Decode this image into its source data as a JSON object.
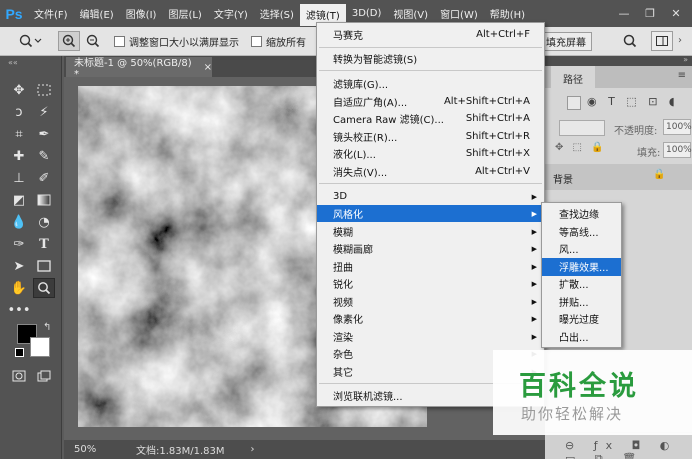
{
  "app": {
    "logo": "Ps",
    "accent": "#1c6fd1"
  },
  "menubar": {
    "items": [
      "文件(F)",
      "编辑(E)",
      "图像(I)",
      "图层(L)",
      "文字(Y)",
      "选择(S)",
      "滤镜(T)",
      "3D(D)",
      "视图(V)",
      "窗口(W)",
      "帮助(H)"
    ],
    "active": "滤镜(T)",
    "controls": [
      "—",
      "❐",
      "✕"
    ]
  },
  "options_bar": {
    "checkbox_resize": "调整窗口大小以满屏显示",
    "checkbox_zoom_all": "缩放所有",
    "fill_screen": "填充屏幕"
  },
  "document": {
    "tab_title": "未标题-1 @ 50%(RGB/8) *",
    "tab_close": "×",
    "zoom": "50%",
    "doc_info": "文档:1.83M/1.83M",
    "status_arrow": "›"
  },
  "filter_menu": {
    "items": [
      {
        "label": "马赛克",
        "shortcut": "Alt+Ctrl+F"
      },
      {
        "label": "转换为智能滤镜(S)",
        "shortcut": ""
      },
      {
        "label": "滤镜库(G)...",
        "shortcut": ""
      },
      {
        "label": "自适应广角(A)...",
        "shortcut": "Alt+Shift+Ctrl+A"
      },
      {
        "label": "Camera Raw 滤镜(C)...",
        "shortcut": "Shift+Ctrl+A"
      },
      {
        "label": "镜头校正(R)...",
        "shortcut": "Shift+Ctrl+R"
      },
      {
        "label": "液化(L)...",
        "shortcut": "Shift+Ctrl+X"
      },
      {
        "label": "消失点(V)...",
        "shortcut": "Alt+Ctrl+V"
      },
      {
        "label": "3D",
        "shortcut": ""
      },
      {
        "label": "风格化",
        "shortcut": ""
      },
      {
        "label": "模糊",
        "shortcut": ""
      },
      {
        "label": "模糊画廊",
        "shortcut": ""
      },
      {
        "label": "扭曲",
        "shortcut": ""
      },
      {
        "label": "锐化",
        "shortcut": ""
      },
      {
        "label": "视频",
        "shortcut": ""
      },
      {
        "label": "像素化",
        "shortcut": ""
      },
      {
        "label": "渲染",
        "shortcut": ""
      },
      {
        "label": "杂色",
        "shortcut": ""
      },
      {
        "label": "其它",
        "shortcut": ""
      },
      {
        "label": "浏览联机滤镜...",
        "shortcut": ""
      }
    ],
    "highlighted": "风格化"
  },
  "stylize_submenu": {
    "items": [
      "查找边缘",
      "等高线...",
      "风...",
      "浮雕效果...",
      "扩散...",
      "拼贴...",
      "曝光过度",
      "凸出..."
    ],
    "highlighted": "浮雕效果..."
  },
  "panel": {
    "tab_paths": "路径",
    "opacity_label": "不透明度:",
    "opacity_value": "100%",
    "fill_label": "填充:",
    "fill_value": "100%",
    "layer_name": "背景"
  },
  "watermark": {
    "title": "百科全说",
    "subtitle": "助你轻松解决",
    "title_color": "#2a9b3e"
  }
}
